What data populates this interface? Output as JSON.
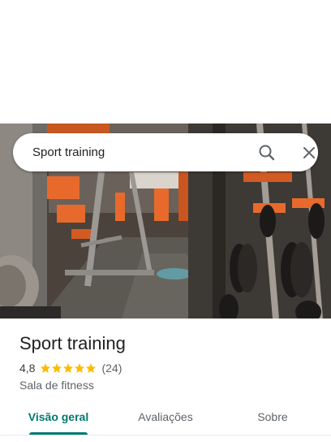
{
  "search": {
    "value": "Sport training",
    "search_icon": "search-icon",
    "close_icon": "close-icon"
  },
  "place": {
    "name": "Sport training",
    "rating": "4,8",
    "stars": 5,
    "star_color": "#fbbc04",
    "review_count": "(24)",
    "category": "Sala de fitness"
  },
  "tabs": [
    {
      "label": "Visão geral",
      "active": true
    },
    {
      "label": "Avaliações",
      "active": false
    },
    {
      "label": "Sobre",
      "active": false
    }
  ],
  "colors": {
    "accent": "#01796f",
    "equipment_orange": "#e8692c"
  }
}
